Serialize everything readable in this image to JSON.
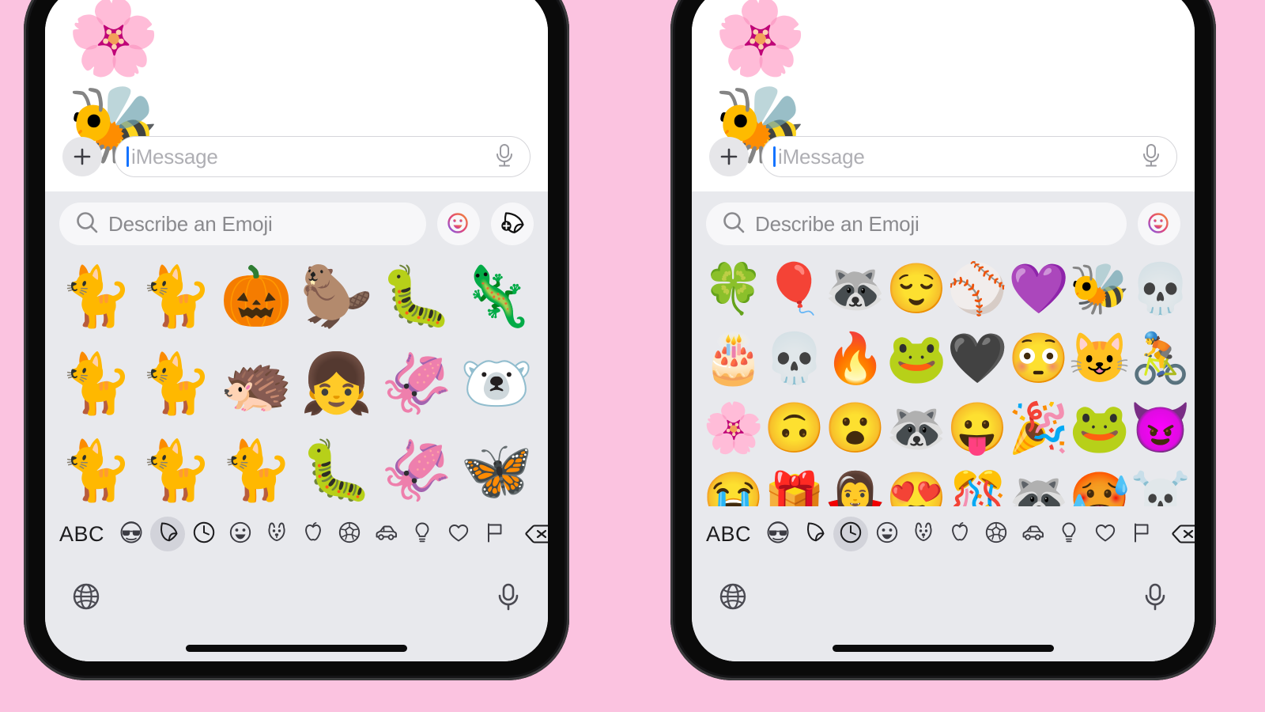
{
  "background_color": "#FBC3E0",
  "phones": [
    {
      "id": "left",
      "variant": "stickers-tab",
      "conversation": {
        "sticker": "🌸🐝",
        "sticker_name": "rainbow-bee-flower-genmoji"
      },
      "compose": {
        "plus_label": "+",
        "placeholder": "iMessage",
        "mic_icon": "microphone-icon",
        "caret_color": "#1473FF"
      },
      "keyboard": {
        "search_placeholder": "Describe an Emoji",
        "search_icon": "search-icon",
        "buttons": [
          {
            "name": "create-genmoji-button",
            "icon": "smiley-plus-icon"
          },
          {
            "name": "add-sticker-button",
            "icon": "sticker-plus-icon"
          }
        ],
        "grid_type": "stickers",
        "columns": 6,
        "items": [
          {
            "glyph": "🐈",
            "name": "sleeping-orange-cat-sticker"
          },
          {
            "glyph": "🐈",
            "name": "standing-cat-sticker"
          },
          {
            "glyph": "🎃",
            "name": "pumpkin-cat-genmoji"
          },
          {
            "glyph": "🦫",
            "name": "confused-beaver-genmoji"
          },
          {
            "glyph": "🐛",
            "name": "caterpillar-sunflowers-genmoji"
          },
          {
            "glyph": "🦎",
            "name": "lizard-with-guitar-genmoji"
          },
          {
            "glyph": "🐈",
            "name": "sitting-cat-sticker"
          },
          {
            "glyph": "🐈",
            "name": "stretching-cat-sticker"
          },
          {
            "glyph": "🦔",
            "name": "hedgehog-hula-hoop-genmoji"
          },
          {
            "glyph": "👧",
            "name": "girl-with-ice-cream-genmoji"
          },
          {
            "glyph": "🦑",
            "name": "pink-squid-genmoji"
          },
          {
            "glyph": "🐻‍❄️",
            "name": "polar-bear-with-fish-genmoji"
          },
          {
            "glyph": "🐈",
            "name": "upright-cat-sticker"
          },
          {
            "glyph": "🐈",
            "name": "lying-cat-sticker"
          },
          {
            "glyph": "🐈",
            "name": "lounging-cat-sticker"
          },
          {
            "glyph": "🐛",
            "name": "green-grumpy-caterpillar-genmoji"
          },
          {
            "glyph": "🦑",
            "name": "pink-squid-genmoji"
          },
          {
            "glyph": "🦋",
            "name": "moth-genmoji"
          }
        ],
        "categories": [
          {
            "name": "abc-key",
            "label": "ABC"
          },
          {
            "name": "memoji-category-icon",
            "icon": "face-sunglasses",
            "active": false
          },
          {
            "name": "stickers-category-icon",
            "icon": "sticker",
            "active": true
          },
          {
            "name": "recents-category-icon",
            "icon": "clock",
            "active": false
          },
          {
            "name": "smileys-category-icon",
            "icon": "smiley",
            "active": false
          },
          {
            "name": "animals-category-icon",
            "icon": "dog",
            "active": false
          },
          {
            "name": "food-category-icon",
            "icon": "apple",
            "active": false
          },
          {
            "name": "activity-category-icon",
            "icon": "soccer-ball",
            "active": false
          },
          {
            "name": "travel-category-icon",
            "icon": "car",
            "active": false
          },
          {
            "name": "objects-category-icon",
            "icon": "lightbulb",
            "active": false
          },
          {
            "name": "symbols-category-icon",
            "icon": "heart",
            "active": false
          },
          {
            "name": "flags-category-icon",
            "icon": "flag",
            "active": false
          }
        ],
        "delete_icon": "backspace-delete-icon"
      },
      "bottom": {
        "globe_icon": "globe-icon",
        "mic_icon": "microphone-icon"
      }
    },
    {
      "id": "right",
      "variant": "recents-tab",
      "conversation": {
        "sticker": "🌸🐝",
        "sticker_name": "rainbow-bee-flower-genmoji"
      },
      "compose": {
        "plus_label": "+",
        "placeholder": "iMessage",
        "mic_icon": "microphone-icon",
        "caret_color": "#1473FF"
      },
      "keyboard": {
        "search_placeholder": "Describe an Emoji",
        "search_icon": "search-icon",
        "buttons": [
          {
            "name": "create-genmoji-button",
            "icon": "smiley-plus-icon"
          }
        ],
        "grid_type": "emojis",
        "columns": 8,
        "items": [
          {
            "glyph": "🍀",
            "name": "four-leaf-clover-emoji"
          },
          {
            "glyph": "🎈",
            "name": "balloon-emoji"
          },
          {
            "glyph": "🦝",
            "name": "raccoon-reading-genmoji"
          },
          {
            "glyph": "😌",
            "name": "relieved-face-emoji"
          },
          {
            "glyph": "⚾",
            "name": "baseball-emoji"
          },
          {
            "glyph": "💜",
            "name": "purple-heart-emoji"
          },
          {
            "glyph": "🐝",
            "name": "honeybee-emoji"
          },
          {
            "glyph": "💀",
            "name": "skull-emoji"
          },
          {
            "glyph": "🎂",
            "name": "birthday-cake-emoji"
          },
          {
            "glyph": "💀",
            "name": "skull-emoji"
          },
          {
            "glyph": "🔥",
            "name": "fire-emoji"
          },
          {
            "glyph": "🐸",
            "name": "frog-emoji"
          },
          {
            "glyph": "🖤",
            "name": "dark-purple-heart-emoji"
          },
          {
            "glyph": "😳",
            "name": "flushed-face-emoji"
          },
          {
            "glyph": "😺",
            "name": "grinning-cat-emoji"
          },
          {
            "glyph": "🚴",
            "name": "cat-on-bicycle-genmoji"
          },
          {
            "glyph": "🌸",
            "name": "rainbow-bee-flower-genmoji"
          },
          {
            "glyph": "🙃",
            "name": "upside-down-face-emoji"
          },
          {
            "glyph": "😮",
            "name": "face-with-open-mouth-emoji"
          },
          {
            "glyph": "🦝",
            "name": "raccoon-with-book-genmoji"
          },
          {
            "glyph": "😛",
            "name": "face-with-tongue-emoji"
          },
          {
            "glyph": "🎉",
            "name": "party-popper-emoji"
          },
          {
            "glyph": "🐸",
            "name": "frog-with-umbrella-genmoji"
          },
          {
            "glyph": "😈",
            "name": "red-devil-genmoji"
          },
          {
            "glyph": "😭",
            "name": "loudly-crying-face-emoji"
          },
          {
            "glyph": "🎁",
            "name": "wrapped-gift-emoji"
          },
          {
            "glyph": "🧛‍♀️",
            "name": "woman-vampire-emoji"
          },
          {
            "glyph": "😍",
            "name": "smiling-face-with-heart-eyes-emoji"
          },
          {
            "glyph": "🎊",
            "name": "confetti-ball-emoji"
          },
          {
            "glyph": "🦝",
            "name": "raccoon-with-donut-genmoji"
          },
          {
            "glyph": "🥵",
            "name": "hot-face-emoji"
          },
          {
            "glyph": "☠️",
            "name": "skull-and-crossbones-emoji"
          }
        ],
        "categories": [
          {
            "name": "abc-key",
            "label": "ABC"
          },
          {
            "name": "memoji-category-icon",
            "icon": "face-sunglasses",
            "active": false
          },
          {
            "name": "stickers-category-icon",
            "icon": "sticker",
            "active": false
          },
          {
            "name": "recents-category-icon",
            "icon": "clock",
            "active": true
          },
          {
            "name": "smileys-category-icon",
            "icon": "smiley",
            "active": false
          },
          {
            "name": "animals-category-icon",
            "icon": "dog",
            "active": false
          },
          {
            "name": "food-category-icon",
            "icon": "apple",
            "active": false
          },
          {
            "name": "activity-category-icon",
            "icon": "soccer-ball",
            "active": false
          },
          {
            "name": "travel-category-icon",
            "icon": "car",
            "active": false
          },
          {
            "name": "objects-category-icon",
            "icon": "lightbulb",
            "active": false
          },
          {
            "name": "symbols-category-icon",
            "icon": "heart",
            "active": false
          },
          {
            "name": "flags-category-icon",
            "icon": "flag",
            "active": false
          }
        ],
        "delete_icon": "backspace-delete-icon"
      },
      "bottom": {
        "globe_icon": "globe-icon",
        "mic_icon": "microphone-icon"
      }
    }
  ]
}
